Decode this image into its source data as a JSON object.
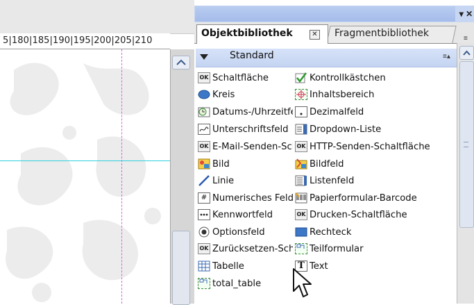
{
  "ruler": {
    "text": "5|180|185|190|195|200|205|210"
  },
  "panel": {
    "close_glyph": "▾ ✕",
    "tabs": [
      {
        "label": "Objektbibliothek",
        "close_glyph": "✕",
        "active": true
      },
      {
        "label": "Fragmentbibliothek",
        "active": false
      }
    ],
    "section": {
      "label": "Standard",
      "menu_glyph": "≡▴"
    },
    "items": [
      {
        "label": "Schaltfläche",
        "icon": "button-ok-icon"
      },
      {
        "label": "Kontrollkästchen",
        "icon": "checkbox-icon"
      },
      {
        "label": "Kreis",
        "icon": "circle-icon"
      },
      {
        "label": "Inhaltsbereich",
        "icon": "content-area-icon"
      },
      {
        "label": "Datums-/Uhrzeitfeld",
        "icon": "date-time-icon"
      },
      {
        "label": "Dezimalfeld",
        "icon": "decimal-field-icon"
      },
      {
        "label": "Unterschriftsfeld",
        "icon": "signature-field-icon"
      },
      {
        "label": "Dropdown-Liste",
        "icon": "dropdown-list-icon"
      },
      {
        "label": "E-Mail-Senden-Schaltfläche",
        "icon": "button-ok-icon"
      },
      {
        "label": "HTTP-Senden-Schaltfläche",
        "icon": "button-ok-icon"
      },
      {
        "label": "Bild",
        "icon": "image-icon"
      },
      {
        "label": "Bildfeld",
        "icon": "image-field-icon"
      },
      {
        "label": "Linie",
        "icon": "line-icon"
      },
      {
        "label": "Listenfeld",
        "icon": "list-box-icon"
      },
      {
        "label": "Numerisches Feld",
        "icon": "numeric-field-icon"
      },
      {
        "label": "Papierformular-Barcode",
        "icon": "barcode-icon"
      },
      {
        "label": "Kennwortfeld",
        "icon": "password-field-icon"
      },
      {
        "label": "Drucken-Schaltfläche",
        "icon": "button-ok-icon"
      },
      {
        "label": "Optionsfeld",
        "icon": "radio-button-icon"
      },
      {
        "label": "Rechteck",
        "icon": "rectangle-icon"
      },
      {
        "label": "Zurücksetzen-Schaltfläche",
        "icon": "button-ok-icon"
      },
      {
        "label": "Teilformular",
        "icon": "subform-icon"
      },
      {
        "label": "Tabelle",
        "icon": "table-icon"
      },
      {
        "label": "Text",
        "icon": "text-icon"
      },
      {
        "label": "total_table",
        "icon": "subform-icon"
      }
    ],
    "button_icon_text": "OK",
    "numeric_icon_text": "#",
    "text_icon_text": "T"
  },
  "colors": {
    "panel_header": "#c7d7f3",
    "section_header": "#d6e2f8",
    "guide_vertical": "#e060d8",
    "guide_horizontal": "#2fd0e0"
  }
}
